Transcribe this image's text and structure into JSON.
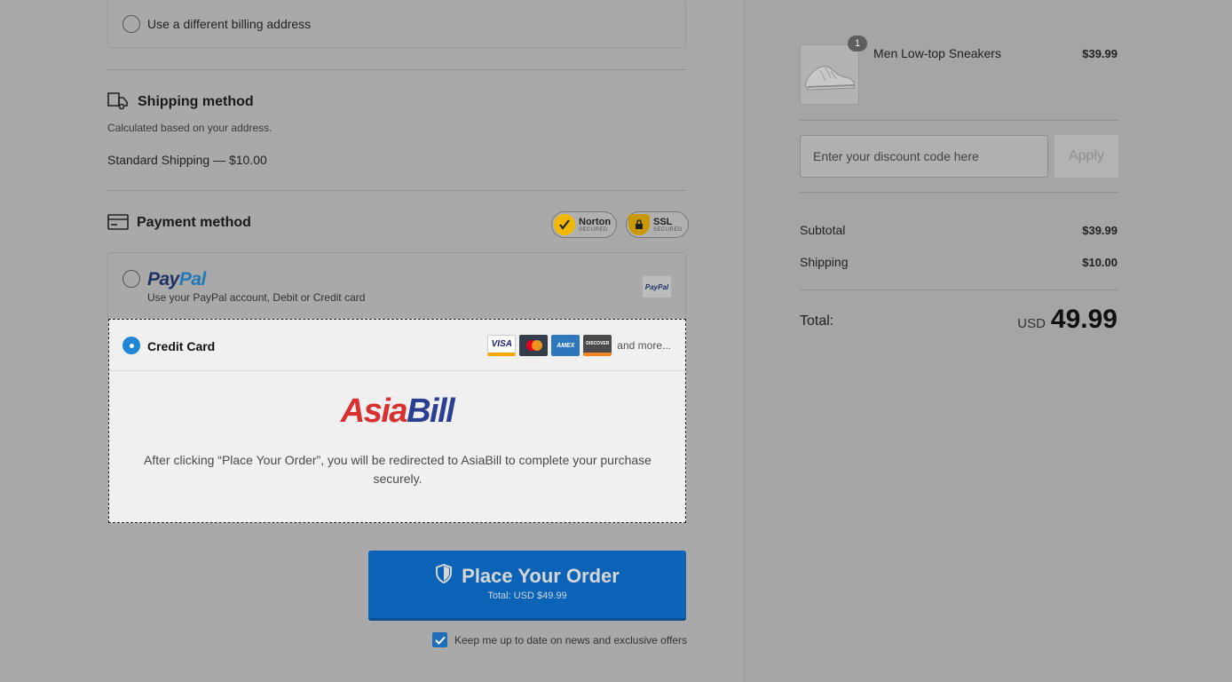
{
  "billing": {
    "different_address_label": "Use a different billing address"
  },
  "shipping": {
    "title": "Shipping method",
    "note": "Calculated based on your address.",
    "option": "Standard Shipping — $10.00"
  },
  "payment": {
    "title": "Payment method",
    "badges": [
      {
        "name": "Norton",
        "sub": "SECURED"
      },
      {
        "name": "SSL",
        "sub": "SECURED"
      }
    ],
    "paypal": {
      "logo_part1": "Pay",
      "logo_part2": "Pal",
      "description": "Use your PayPal account, Debit or Credit card",
      "mini_logo": "PayPal"
    },
    "credit_card": {
      "label": "Credit Card",
      "cards": [
        {
          "name": "visa-card-icon",
          "text": "VISA"
        },
        {
          "name": "mastercard-icon",
          "text": ""
        },
        {
          "name": "amex-card-icon",
          "text": "AMEX"
        },
        {
          "name": "discover-card-icon",
          "text": "DISCOVER"
        }
      ],
      "and_more": "and more...",
      "processor_logo_part1": "Asia",
      "processor_logo_part2": "Bill",
      "redirect_text": "After clicking “Place Your Order”, you will be redirected to AsiaBill to complete your purchase securely."
    },
    "selected": "credit_card"
  },
  "order_button": {
    "label": "Place Your Order",
    "subtext": "Total: USD $49.99"
  },
  "newsletter": {
    "label": "Keep me up to date on news and exclusive offers",
    "checked": true
  },
  "summary": {
    "item": {
      "quantity": "1",
      "name": "Men Low-top Sneakers",
      "price": "$39.99"
    },
    "discount": {
      "placeholder": "Enter your discount code here",
      "apply_label": "Apply"
    },
    "subtotal_label": "Subtotal",
    "subtotal_value": "$39.99",
    "shipping_label": "Shipping",
    "shipping_value": "$10.00",
    "total_label": "Total:",
    "total_currency": "USD",
    "total_amount": "49.99"
  },
  "colors": {
    "overlay_bg": "#a9a9a9",
    "accent_blue": "#0b63b8",
    "radio_selected": "#1f86d6"
  }
}
